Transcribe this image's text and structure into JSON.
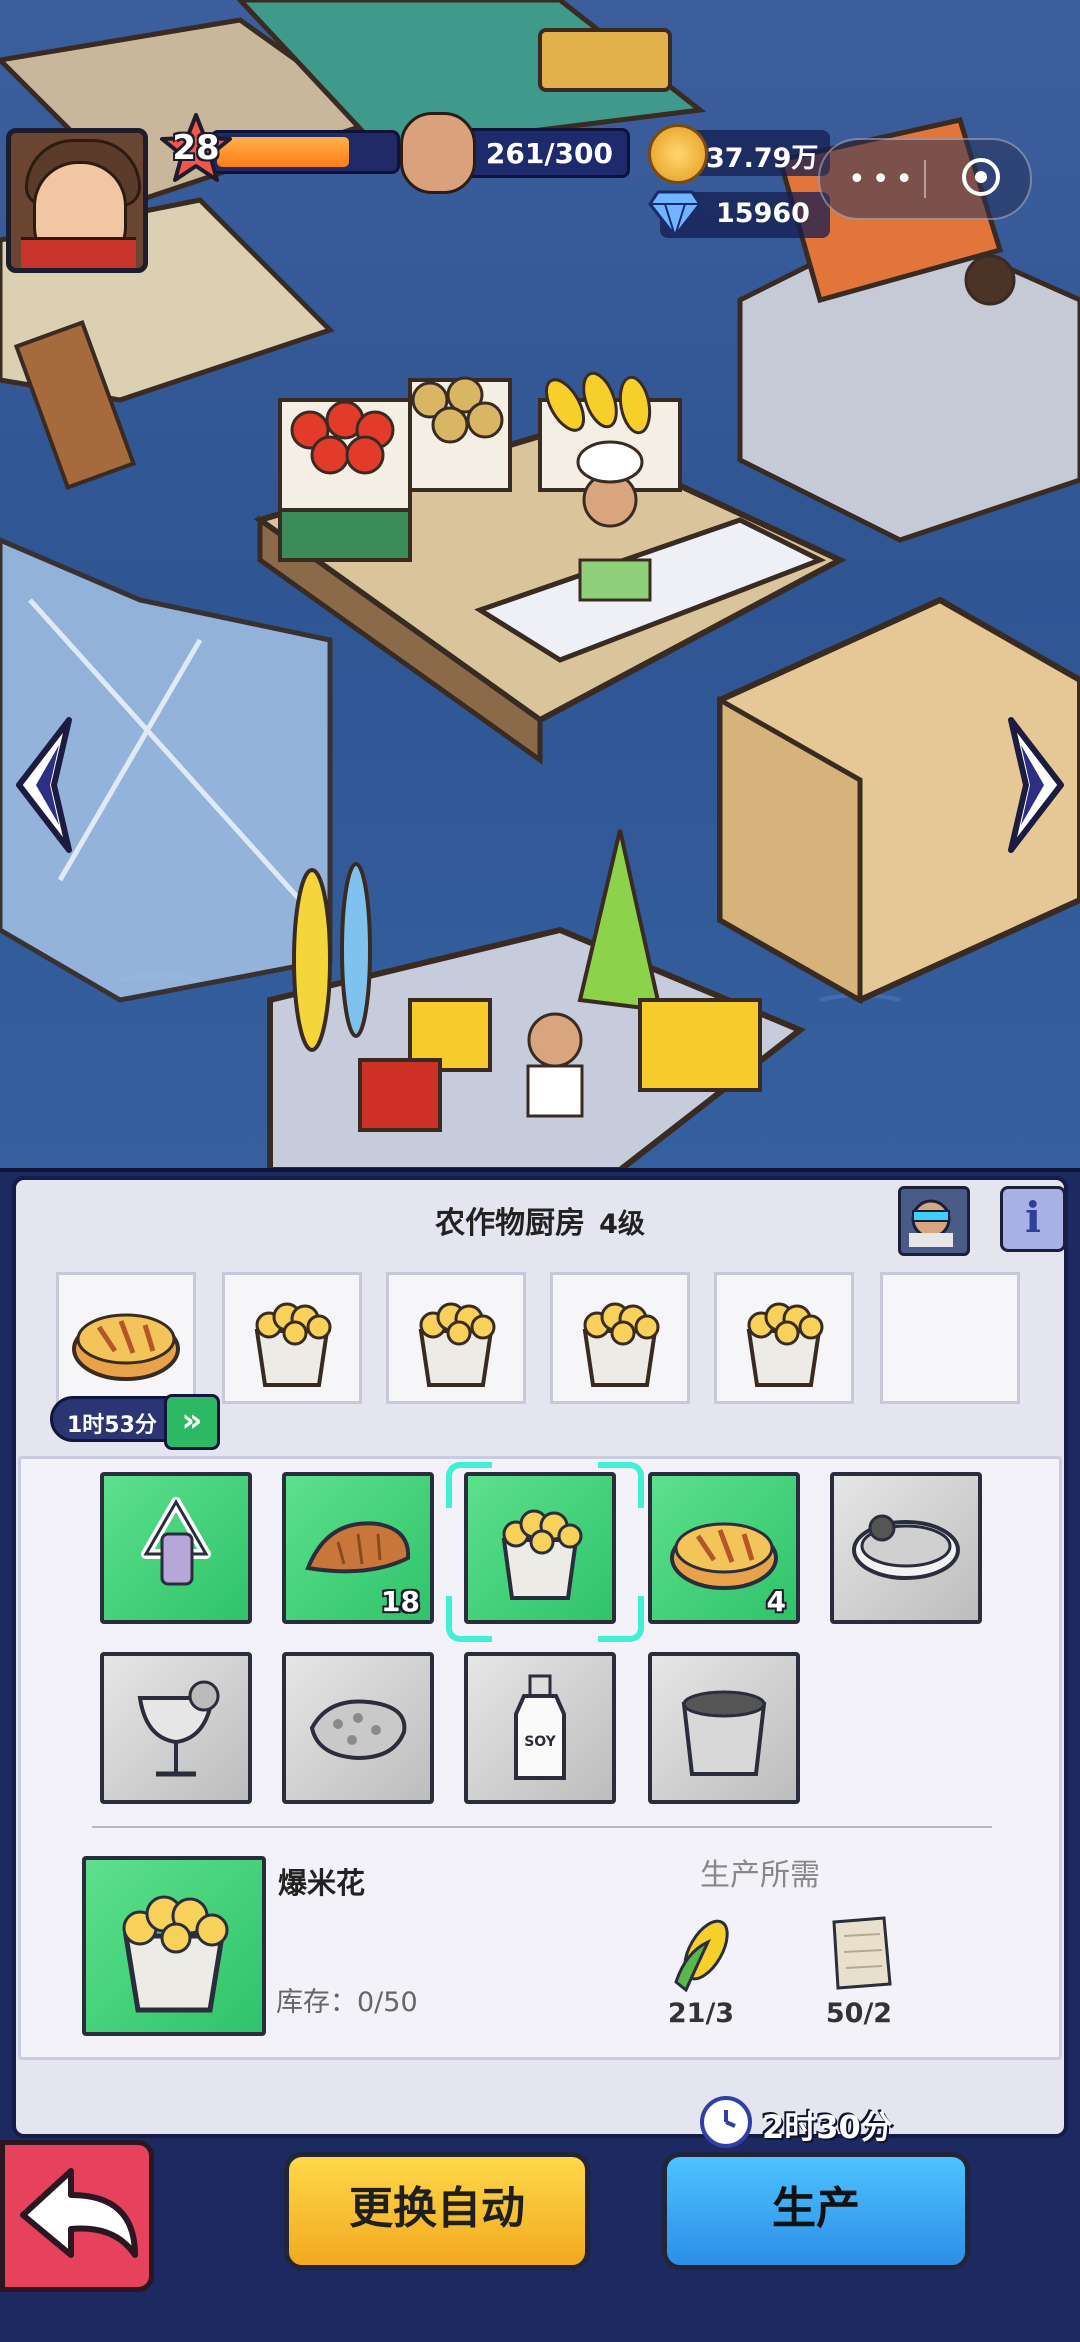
{
  "hud": {
    "level": "28",
    "xp_progress": 0.72,
    "population": "261/300",
    "coins": "37.79万",
    "gems": "15960"
  },
  "panel": {
    "title": "农作物厨房",
    "level": "4级",
    "info_label": "i",
    "queue_timer": "1时53分",
    "speed_label": "»",
    "recipes": [
      {
        "name": "recycle-icon",
        "state": "unlocked",
        "count": ""
      },
      {
        "name": "bread-icon",
        "state": "unlocked",
        "count": "18"
      },
      {
        "name": "popcorn-icon",
        "state": "selected",
        "count": ""
      },
      {
        "name": "pie-icon",
        "state": "unlocked",
        "count": "4"
      },
      {
        "name": "soup-bowl-icon",
        "state": "locked",
        "count": ""
      },
      {
        "name": "cocktail-icon",
        "state": "locked",
        "count": ""
      },
      {
        "name": "cracker-icon",
        "state": "locked",
        "count": ""
      },
      {
        "name": "soy-bottle-icon",
        "state": "locked",
        "count": ""
      },
      {
        "name": "bucket-icon",
        "state": "locked",
        "count": ""
      }
    ],
    "soy_label": "SOY",
    "selected": {
      "name": "爆米花",
      "stock": "库存：0/50",
      "requirements_title": "生产所需",
      "requirements": [
        {
          "icon": "corn-icon",
          "value": "21/3"
        },
        {
          "icon": "paper-icon",
          "value": "50/2"
        }
      ],
      "duration": "2时30分"
    },
    "buttons": {
      "auto": "更换自动",
      "produce": "生产"
    }
  },
  "colors": {
    "panel_bg": "#1d2a61",
    "unlocked_tile": "#3fd07a",
    "auto_button": "#f7c232",
    "produce_button": "#3aa8f2",
    "back_button": "#e6425d"
  }
}
